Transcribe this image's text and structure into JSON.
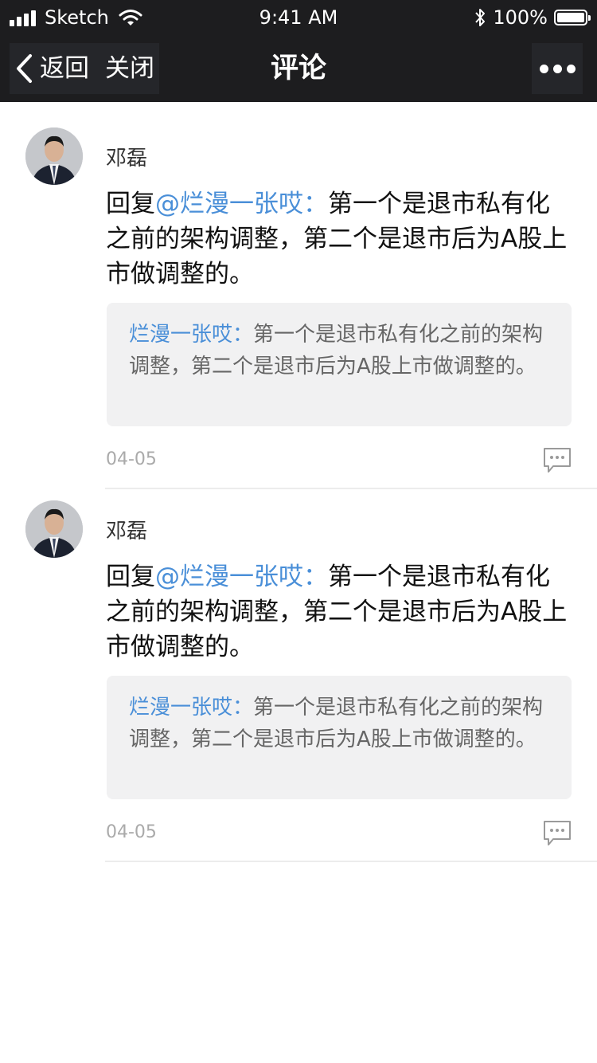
{
  "status_bar": {
    "carrier": "Sketch",
    "time": "9:41 AM",
    "battery_percent": "100%",
    "battery_level": 1.0,
    "signal_bars": 4
  },
  "nav": {
    "back_label": "返回",
    "close_label": "关闭",
    "title": "评论"
  },
  "comments": [
    {
      "author": "邓磊",
      "reply_prefix": "回复",
      "mention": "@烂漫一张哎：",
      "text": "第一个是退市私有化之前的架构调整，第二个是退市后为A股上市做调整的。",
      "quote_author": "烂漫一张哎：",
      "quote_text": "第一个是退市私有化之前的架构调整，第二个是退市后为A股上市做调整的。",
      "date": "04-05"
    },
    {
      "author": "邓磊",
      "reply_prefix": "回复",
      "mention": "@烂漫一张哎：",
      "text": "第一个是退市私有化之前的架构调整，第二个是退市后为A股上市做调整的。",
      "quote_author": "烂漫一张哎：",
      "quote_text": "第一个是退市私有化之前的架构调整，第二个是退市后为A股上市做调整的。",
      "date": "04-05"
    }
  ],
  "colors": {
    "nav_background": "#1d1d1f",
    "link": "#4a8fd8",
    "quote_background": "#f1f1f2",
    "date": "#aaaaaa"
  },
  "icons": {
    "back": "chevron-left-icon",
    "more": "more-dots-icon",
    "reply": "comment-bubble-icon",
    "wifi": "wifi-icon",
    "bluetooth": "bluetooth-icon",
    "battery": "battery-icon",
    "signal": "signal-icon"
  }
}
